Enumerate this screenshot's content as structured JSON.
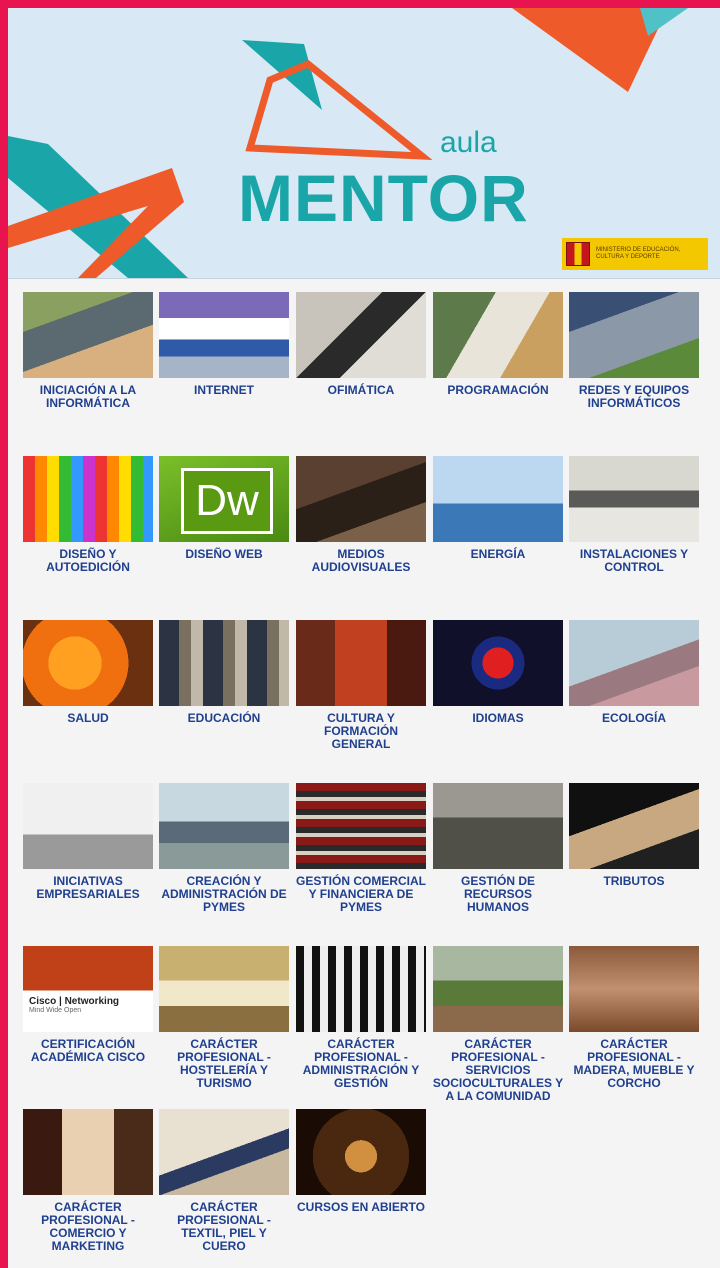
{
  "header": {
    "brand_small": "aula",
    "brand_large": "MENTOR",
    "ministry_text": "MINISTERIO DE EDUCACIÓN, CULTURA Y DEPORTE"
  },
  "categories": [
    {
      "label": "INICIACIÓN A LA INFORMÁTICA",
      "icon": "person-computer-photo"
    },
    {
      "label": "INTERNET",
      "icon": "browser-photo"
    },
    {
      "label": "OFIMÁTICA",
      "icon": "calculator-glasses-photo"
    },
    {
      "label": "PROGRAMACIÓN",
      "icon": "tablet-photo"
    },
    {
      "label": "REDES Y EQUIPOS INFORMÁTICOS",
      "icon": "network-equipment-photo"
    },
    {
      "label": "DISEÑO Y AUTOEDICIÓN",
      "icon": "colored-pencils-photo"
    },
    {
      "label": "DISEÑO WEB",
      "icon": "dreamweaver-logo"
    },
    {
      "label": "MEDIOS AUDIOVISUALES",
      "icon": "film-crew-photo"
    },
    {
      "label": "ENERGÍA",
      "icon": "wind-turbines-photo"
    },
    {
      "label": "INSTALACIONES Y CONTROL",
      "icon": "electrical-panel-photo"
    },
    {
      "label": "SALUD",
      "icon": "oranges-photo"
    },
    {
      "label": "EDUCACIÓN",
      "icon": "students-photo"
    },
    {
      "label": "CULTURA Y FORMACIÓN GENERAL",
      "icon": "museum-photo"
    },
    {
      "label": "IDIOMAS",
      "icon": "underground-sign-photo"
    },
    {
      "label": "ECOLOGÍA",
      "icon": "blossom-photo"
    },
    {
      "label": "INICIATIVAS EMPRESARIALES",
      "icon": "walking-people-photo"
    },
    {
      "label": "CREACIÓN Y ADMINISTRACIÓN DE PYMES",
      "icon": "city-skyline-photo"
    },
    {
      "label": "GESTIÓN COMERCIAL Y FINANCIERA DE PYMES",
      "icon": "stacked-books-photo"
    },
    {
      "label": "GESTIÓN DE RECURSOS HUMANOS",
      "icon": "crowd-photo"
    },
    {
      "label": "TRIBUTOS",
      "icon": "money-house-photo"
    },
    {
      "label": "CERTIFICACIÓN ACADÉMICA CISCO",
      "icon": "cisco-networking-photo",
      "overlay": "Cisco | Networking",
      "overlay_sub": "Mind Wide Open"
    },
    {
      "label": "CARÁCTER PROFESIONAL - HOSTELERÍA Y TURISMO",
      "icon": "hotel-facade-photo"
    },
    {
      "label": "CARÁCTER PROFESIONAL - ADMINISTRACIÓN Y GESTIÓN",
      "icon": "building-columns-photo"
    },
    {
      "label": "CARÁCTER PROFESIONAL - SERVICIOS SOCIOCULTURALES Y A LA COMUNIDAD",
      "icon": "playground-photo"
    },
    {
      "label": "CARÁCTER PROFESIONAL - MADERA, MUEBLE Y CORCHO",
      "icon": "wood-texture-photo"
    },
    {
      "label": "CARÁCTER PROFESIONAL - COMERCIO Y MARKETING",
      "icon": "shop-window-photo"
    },
    {
      "label": "CARÁCTER PROFESIONAL - TEXTIL, PIEL Y CUERO",
      "icon": "scissors-photo"
    },
    {
      "label": "CURSOS EN ABIERTO",
      "icon": "lights-hands-photo"
    }
  ]
}
